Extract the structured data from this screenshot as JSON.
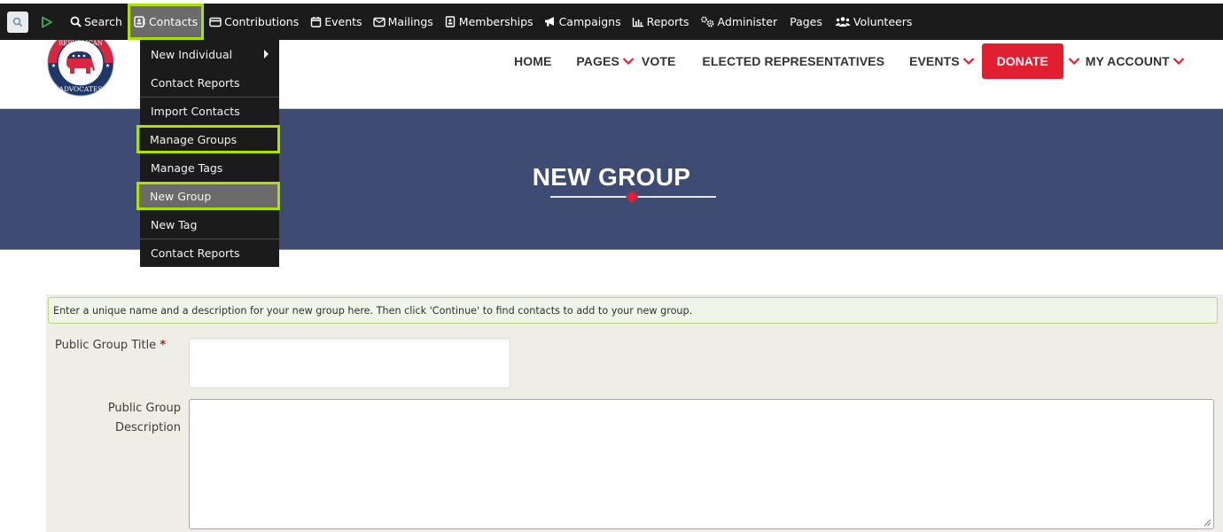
{
  "civi_menu": {
    "quicksearch_icon": "search-icon",
    "civi_logo_icon": "civicrm-logo-icon",
    "items": [
      {
        "label": "Search",
        "icon": "search-icon"
      },
      {
        "label": "Contacts",
        "icon": "address-card-icon",
        "active": true
      },
      {
        "label": "Contributions",
        "icon": "credit-card-icon"
      },
      {
        "label": "Events",
        "icon": "calendar-icon"
      },
      {
        "label": "Mailings",
        "icon": "envelope-icon"
      },
      {
        "label": "Memberships",
        "icon": "id-badge-icon"
      },
      {
        "label": "Campaigns",
        "icon": "bullhorn-icon"
      },
      {
        "label": "Reports",
        "icon": "bar-chart-icon"
      },
      {
        "label": "Administer",
        "icon": "gears-icon"
      },
      {
        "label": "Pages",
        "icon": ""
      },
      {
        "label": "Volunteers",
        "icon": "users-icon"
      }
    ]
  },
  "contacts_dropdown": {
    "items": [
      {
        "label": "New Individual",
        "has_submenu": true
      },
      {
        "label": "Contact Reports"
      },
      {
        "label": "Import Contacts"
      },
      {
        "label": "Manage Groups",
        "highlighted": true
      },
      {
        "label": "Manage Tags"
      },
      {
        "label": "New Group",
        "highlighted": true,
        "hover": true
      },
      {
        "label": "New Tag"
      },
      {
        "label": "Contact Reports"
      }
    ]
  },
  "site_header": {
    "logo_alt": "Republican Advocates",
    "logo_text_top": "REPUBLICAN",
    "logo_text_bottom": "ADVOCATES",
    "nav": {
      "home": "HOME",
      "pages": "PAGES",
      "vote": "VOTE",
      "elected": "ELECTED REPRESENTATIVES",
      "events": "EVENTS",
      "donate": "DONATE",
      "account": "MY ACCOUNT"
    },
    "brand_red": "#e21f30",
    "brand_navy": "#3e4c74"
  },
  "hero": {
    "title": "NEW GROUP"
  },
  "form": {
    "help_text": "Enter a unique name and a description for your new group here. Then click 'Continue' to find contacts to add to your new group.",
    "title_label": "Public Group Title",
    "required_marker": "*",
    "title_value": "",
    "description_label_line1": "Public Group",
    "description_label_line2": "Description",
    "description_value": ""
  },
  "highlight_color": "#aee000"
}
